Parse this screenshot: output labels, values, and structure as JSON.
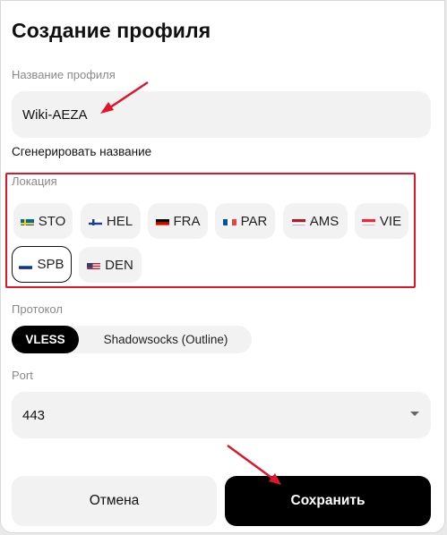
{
  "dialog": {
    "title": "Создание профиля",
    "profile_name": {
      "label": "Название профиля",
      "value": "Wiki-AEZA"
    },
    "generate_link": "Сгенерировать название",
    "location": {
      "label": "Локация",
      "selected": "SPB",
      "items": [
        {
          "code": "STO",
          "flag": "sweden"
        },
        {
          "code": "HEL",
          "flag": "finland"
        },
        {
          "code": "FRA",
          "flag": "germany"
        },
        {
          "code": "PAR",
          "flag": "france"
        },
        {
          "code": "AMS",
          "flag": "netherlands"
        },
        {
          "code": "VIE",
          "flag": "austria"
        },
        {
          "code": "SPB",
          "flag": "russia"
        },
        {
          "code": "DEN",
          "flag": "usa"
        }
      ]
    },
    "protocol": {
      "label": "Протокол",
      "options": [
        "VLESS",
        "Shadowsocks (Outline)"
      ],
      "selected": "VLESS"
    },
    "port": {
      "label": "Port",
      "value": "443"
    },
    "buttons": {
      "cancel": "Отмена",
      "save": "Сохранить"
    }
  },
  "colors": {
    "annotation_red": "#e0152a",
    "field_bg": "#f2f2f2",
    "primary": "#000000"
  }
}
